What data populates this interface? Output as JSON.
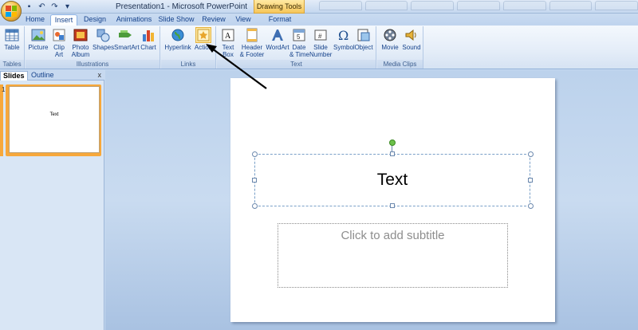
{
  "window": {
    "title": "Presentation1 - Microsoft PowerPoint",
    "contextual_tab": "Drawing Tools"
  },
  "tabs": [
    "Home",
    "Insert",
    "Design",
    "Animations",
    "Slide Show",
    "Review",
    "View",
    "Format"
  ],
  "active_tab": "Insert",
  "ribbon": {
    "groups": {
      "tables": "Tables",
      "illustrations": "Illustrations",
      "links": "Links",
      "text": "Text",
      "media": "Media Clips"
    },
    "buttons": {
      "table": [
        "Table",
        ""
      ],
      "picture": [
        "Picture",
        ""
      ],
      "clip_art": [
        "Clip",
        "Art"
      ],
      "photo_album": [
        "Photo",
        "Album"
      ],
      "shapes": [
        "Shapes",
        ""
      ],
      "smartart": [
        "SmartArt",
        ""
      ],
      "chart": [
        "Chart",
        ""
      ],
      "hyperlink": [
        "Hyperlink",
        ""
      ],
      "action": [
        "Action",
        ""
      ],
      "text_box": [
        "Text",
        "Box"
      ],
      "header_footer": [
        "Header",
        "& Footer"
      ],
      "wordart": [
        "WordArt",
        ""
      ],
      "date_time": [
        "Date",
        "& Time"
      ],
      "slide_number": [
        "Slide",
        "Number"
      ],
      "symbol": [
        "Symbol",
        ""
      ],
      "object": [
        "Object",
        ""
      ],
      "movie": [
        "Movie",
        ""
      ],
      "sound": [
        "Sound",
        ""
      ]
    }
  },
  "panel": {
    "tabs": [
      "Slides",
      "Outline"
    ],
    "close": "x",
    "slide_number": "1",
    "thumb_text": "Text"
  },
  "slide": {
    "title": "Text",
    "subtitle_placeholder": "Click to add subtitle"
  },
  "colors": {
    "accent": "#15428b",
    "thumb_highlight": "#f7a83b",
    "rotate_handle": "#6cc04a"
  }
}
